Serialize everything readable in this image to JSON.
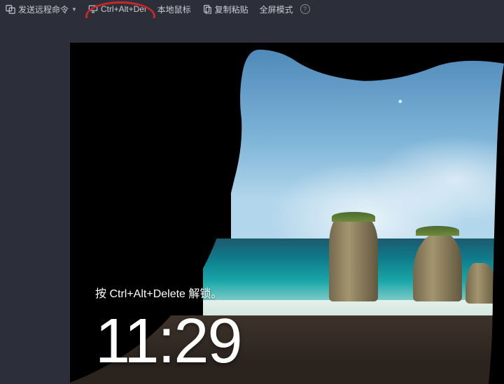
{
  "toolbar": {
    "send_cmd_label": "发送远程命令",
    "ctrl_alt_del_label": "Ctrl+Alt+Del",
    "local_mouse_label": "本地鼠标",
    "copy_paste_label": "复制粘贴",
    "fullscreen_label": "全屏模式",
    "help_label": "?"
  },
  "lockscreen": {
    "unlock_text": "按 Ctrl+Alt+Delete 解锁。",
    "time": "11:29"
  }
}
